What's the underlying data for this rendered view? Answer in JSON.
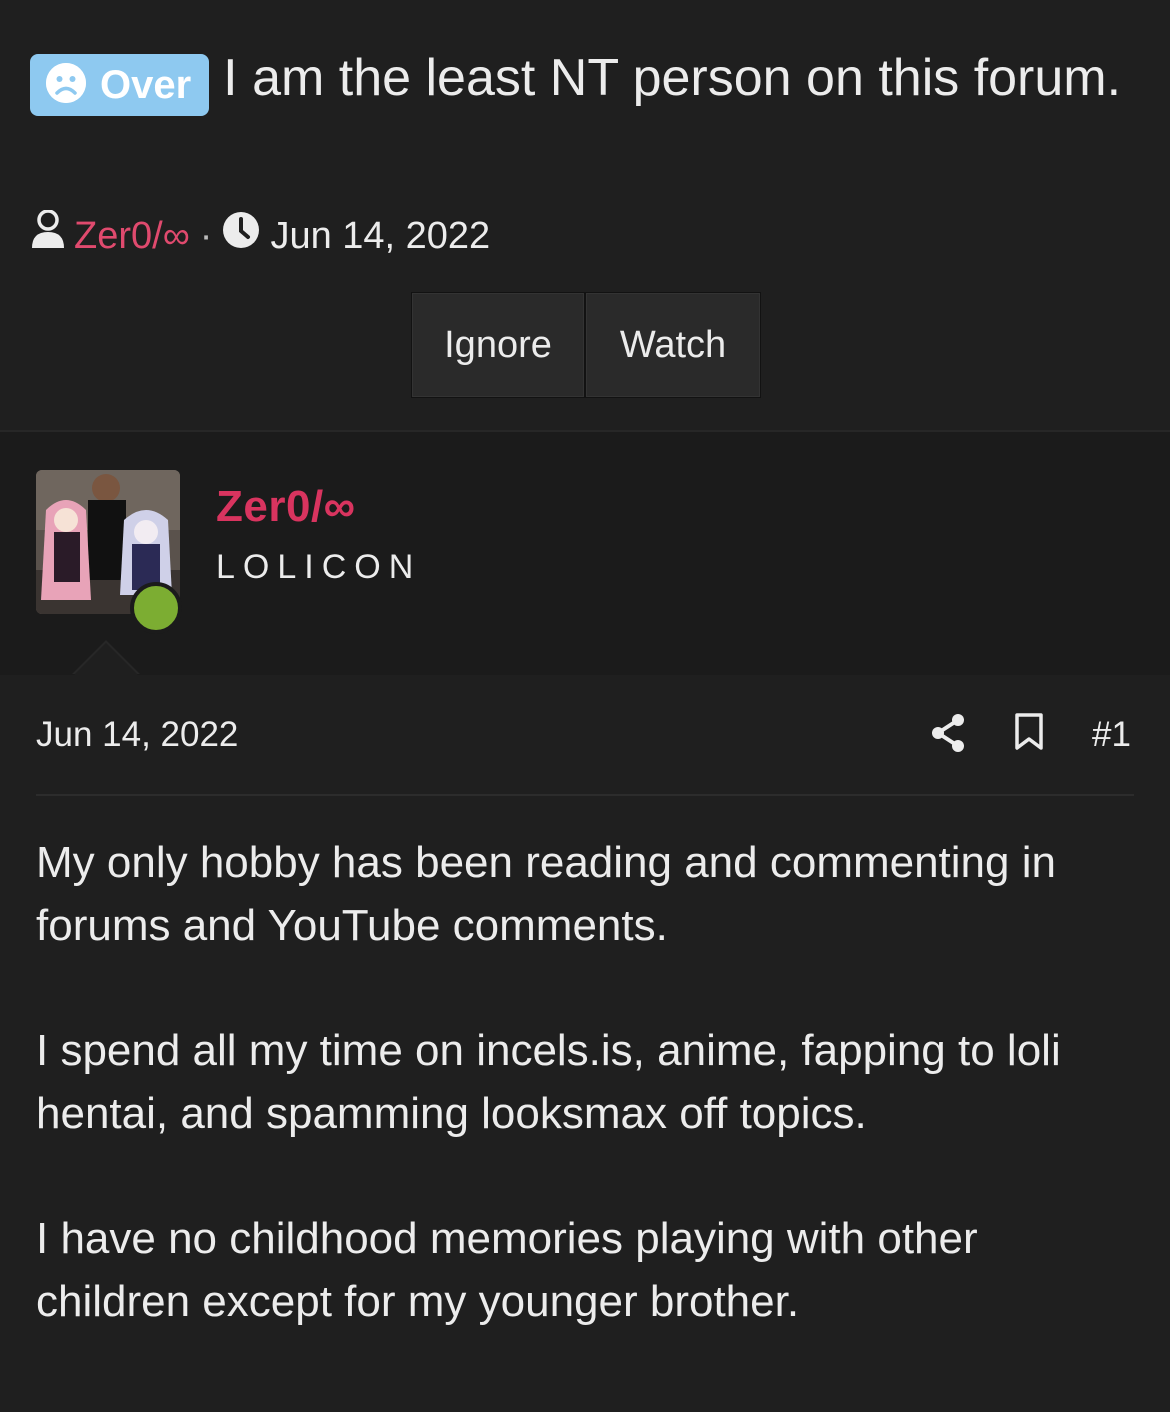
{
  "thread": {
    "prefix": "Over",
    "title": "I am the least NT person on this forum.",
    "author": "Zer0/∞",
    "separator": "·",
    "date": "Jun 14, 2022"
  },
  "buttons": {
    "ignore": "Ignore",
    "watch": "Watch"
  },
  "user": {
    "name": "Zer0/∞",
    "title": "LOLICON",
    "online": true
  },
  "post": {
    "date": "Jun 14, 2022",
    "number": "#1",
    "paragraphs": [
      "My only hobby has been reading and commenting in forums and YouTube comments.",
      "I spend all my time on incels.is, anime, fapping to loli hentai, and spamming looksmax off topics.",
      "I have no childhood memories playing with other children except for my younger brother."
    ]
  },
  "icons": {
    "prefix": "frown-face-icon",
    "author": "user-icon",
    "date": "clock-icon",
    "share": "share-icon",
    "bookmark": "bookmark-icon"
  },
  "colors": {
    "background": "#1f1f1f",
    "prefix_badge": "#8ec9f0",
    "username": "#d9345f",
    "online_dot": "#7cad32"
  }
}
